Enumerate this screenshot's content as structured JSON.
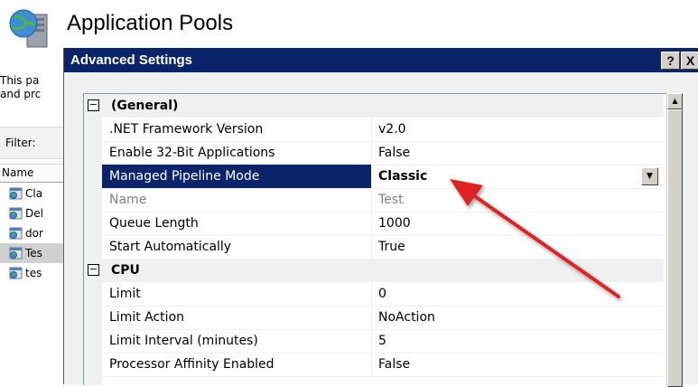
{
  "page": {
    "title": "Application Pools",
    "description_line1": "This pa",
    "description_line2": "and prc",
    "filter_label": "Filter:",
    "name_column": "Name",
    "pools": [
      {
        "label": "Cla",
        "selected": false
      },
      {
        "label": "Del",
        "selected": false
      },
      {
        "label": "dor",
        "selected": false
      },
      {
        "label": "Tes",
        "selected": true
      },
      {
        "label": "tes",
        "selected": false
      }
    ]
  },
  "dialog": {
    "title": "Advanced Settings",
    "help_label": "?",
    "close_label": "X",
    "sections": [
      {
        "name": "(General)",
        "toggle": "−",
        "properties": [
          {
            "name": ".NET Framework Version",
            "value": "v2.0"
          },
          {
            "name": "Enable 32-Bit Applications",
            "value": "False"
          },
          {
            "name": "Managed Pipeline Mode",
            "value": "Classic",
            "selected": true
          },
          {
            "name": "Name",
            "value": "Test",
            "disabled": true
          },
          {
            "name": "Queue Length",
            "value": "1000"
          },
          {
            "name": "Start Automatically",
            "value": "True"
          }
        ]
      },
      {
        "name": "CPU",
        "toggle": "−",
        "properties": [
          {
            "name": "Limit",
            "value": "0"
          },
          {
            "name": "Limit Action",
            "value": "NoAction"
          },
          {
            "name": "Limit Interval (minutes)",
            "value": "5"
          },
          {
            "name": "Processor Affinity Enabled",
            "value": "False"
          }
        ]
      }
    ]
  },
  "annotation": {
    "arrow_color": "#e02020"
  },
  "icons": {
    "page": "globe-server-icon",
    "pool": "application-pool-icon",
    "dropdown": "chevron-down-icon",
    "scroll_up": "arrow-up-icon"
  }
}
